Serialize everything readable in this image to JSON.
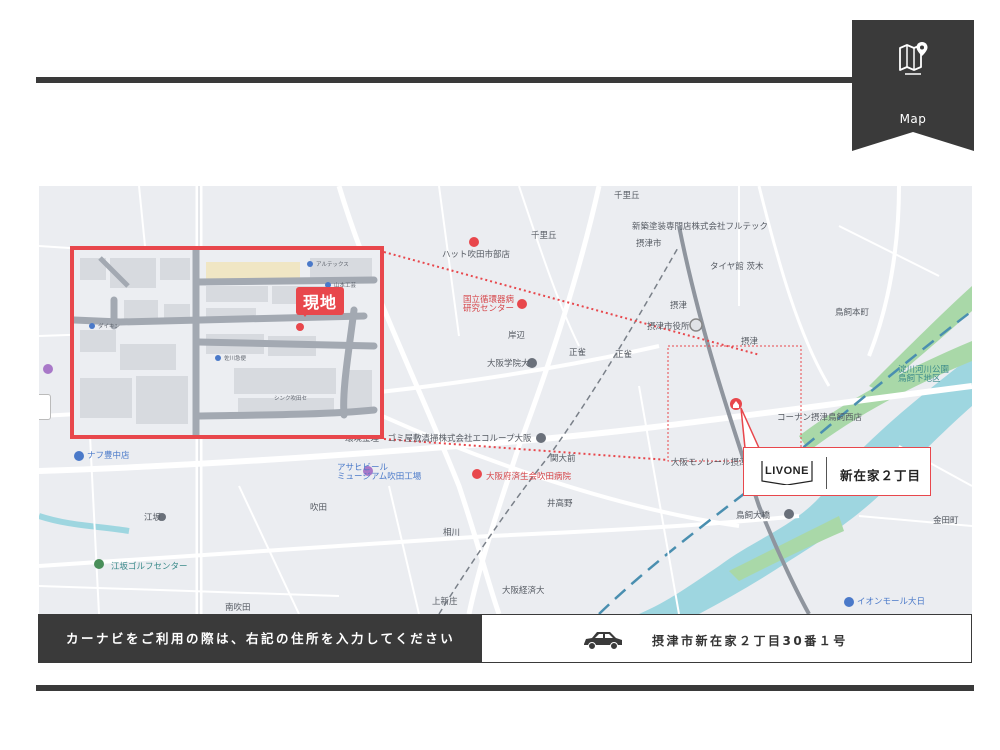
{
  "header": {
    "badge_label": "Map",
    "badge_icon": "map-pin-icon"
  },
  "map": {
    "labels": {
      "senrioka": "千里丘",
      "futtec": "新築塗装専門店株式会社フルテック",
      "settsu_shi": "摂津市",
      "tire": "タイヤ館 茨木",
      "senrioka2": "千里丘",
      "suita_hospital": "ハット吹田市部店",
      "settsu": "摂津",
      "ncvc": "国立循環器病\n研究センター",
      "kishibe": "岸辺",
      "settsu_city_office": "摂津市役所",
      "settsu_station": "摂津",
      "shosei": "正雀",
      "shosei2": "正雀",
      "osaka_gakuin": "大阪学院大",
      "torikai": "鳥飼本町",
      "yodogawa_park": "淀川河川公園\n鳥飼下地区",
      "konan": "コーナン摂津鳥飼西店",
      "ecoloop": "環境整理・ゴミ屋敷清掃株式会社エコループ大阪",
      "asahi_beer": "アサヒビール\nミュージアム吹田工場",
      "osaka_hospital": "大阪府済生会吹田病院",
      "seki": "関大前",
      "settsu_monorail": "大阪モノレール摂津",
      "ikea": "ナフ豊中店",
      "esaka": "江坂",
      "esaka_golf": "江坂ゴルフセンター",
      "suita": "吹田",
      "aikawa": "相川",
      "imigaoka": "井高野",
      "torikaiohashi": "鳥飼大橋",
      "kamishinjo": "上新庄",
      "osaka_keizai": "大阪経済大",
      "minami_esaka": "南吹田",
      "aeon": "イオンモール大日",
      "kaneda": "金田町",
      "inset_altex": "アルテックス",
      "inset_yamamoto": "山本工芸",
      "inset_daikin": "ダイキン",
      "inset_sagawa": "佐川急便",
      "inset_shin": "シンク吹田セ"
    },
    "site_label": "現地",
    "destination": {
      "logo_text": "LIVONE",
      "name": "新在家２丁目"
    }
  },
  "navi": {
    "instruction": "カーナビをご利用の際は、右記の住所を入力してください",
    "car_icon": "car-icon",
    "address": "摂津市新在家２丁目30番１号"
  },
  "colors": {
    "dark": "#3a3a3a",
    "accent_red": "#e8474c",
    "map_bg": "#ebedf1",
    "river": "#9ed6e0",
    "park": "#a9d8a8"
  }
}
